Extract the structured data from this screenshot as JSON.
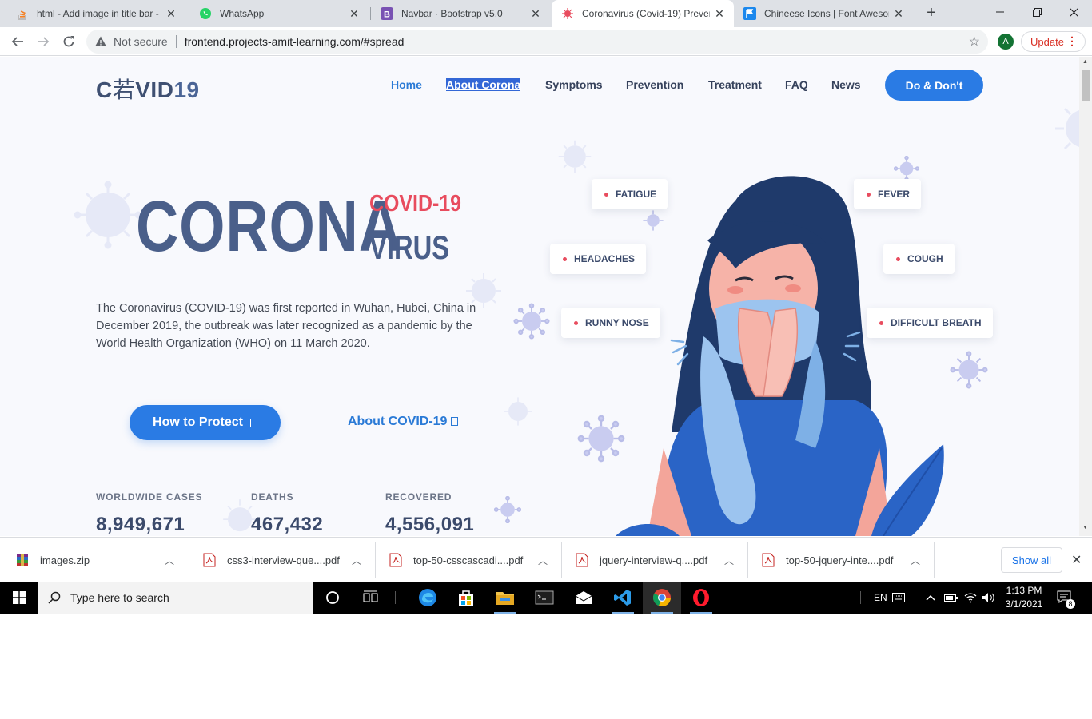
{
  "browser": {
    "tabs": [
      {
        "title": "html - Add image in title bar -"
      },
      {
        "title": "WhatsApp"
      },
      {
        "title": "Navbar · Bootstrap v5.0"
      },
      {
        "title": "Coronavirus (Covid-19) Prevent"
      },
      {
        "title": "Chineese Icons | Font Awesom"
      }
    ],
    "security_label": "Not secure",
    "url": "frontend.projects-amit-learning.com/#spread",
    "profile_initial": "A",
    "update_label": "Update"
  },
  "page": {
    "logo": {
      "prefix": "C",
      "glyph": "若",
      "suffix": "VID",
      "number": "19"
    },
    "nav": [
      "Home",
      "About Corona",
      "Symptoms",
      "Prevention",
      "Treatment",
      "FAQ",
      "News"
    ],
    "cta_label": "Do & Don't",
    "hero": {
      "big_word": "CORONA",
      "tag": "COVID-19",
      "sub_word": "VIRUS",
      "description": "The Coronavirus (COVID-19) was first reported in Wuhan, Hubei, China in December 2019, the outbreak was later recognized as a pandemic by the World Health Organization (WHO) on 11 March 2020."
    },
    "buttons": {
      "protect": "How to Protect",
      "about": "About COVID-19"
    },
    "stats": [
      {
        "label": "WORLDWIDE CASES",
        "value": "8,949,671"
      },
      {
        "label": "DEATHS",
        "value": "467,432"
      },
      {
        "label": "RECOVERED",
        "value": "4,556,091"
      }
    ],
    "symptoms": [
      "FATIGUE",
      "FEVER",
      "HEADACHES",
      "COUGH",
      "RUNNY NOSE",
      "DIFFICULT BREATH"
    ]
  },
  "downloads": {
    "items": [
      "images.zip",
      "css3-interview-que....pdf",
      "top-50-csscascadi....pdf",
      "jquery-interview-q....pdf",
      "top-50-jquery-inte....pdf"
    ],
    "show_all": "Show all"
  },
  "taskbar": {
    "search_placeholder": "Type here to search",
    "language": "EN",
    "time": "1:13 PM",
    "date": "3/1/2021",
    "notification_count": "8"
  },
  "colors": {
    "accent": "#2a7be4",
    "heading": "#4a5f8a",
    "alert": "#e84c5e",
    "page_bg": "#f8f9fd"
  }
}
